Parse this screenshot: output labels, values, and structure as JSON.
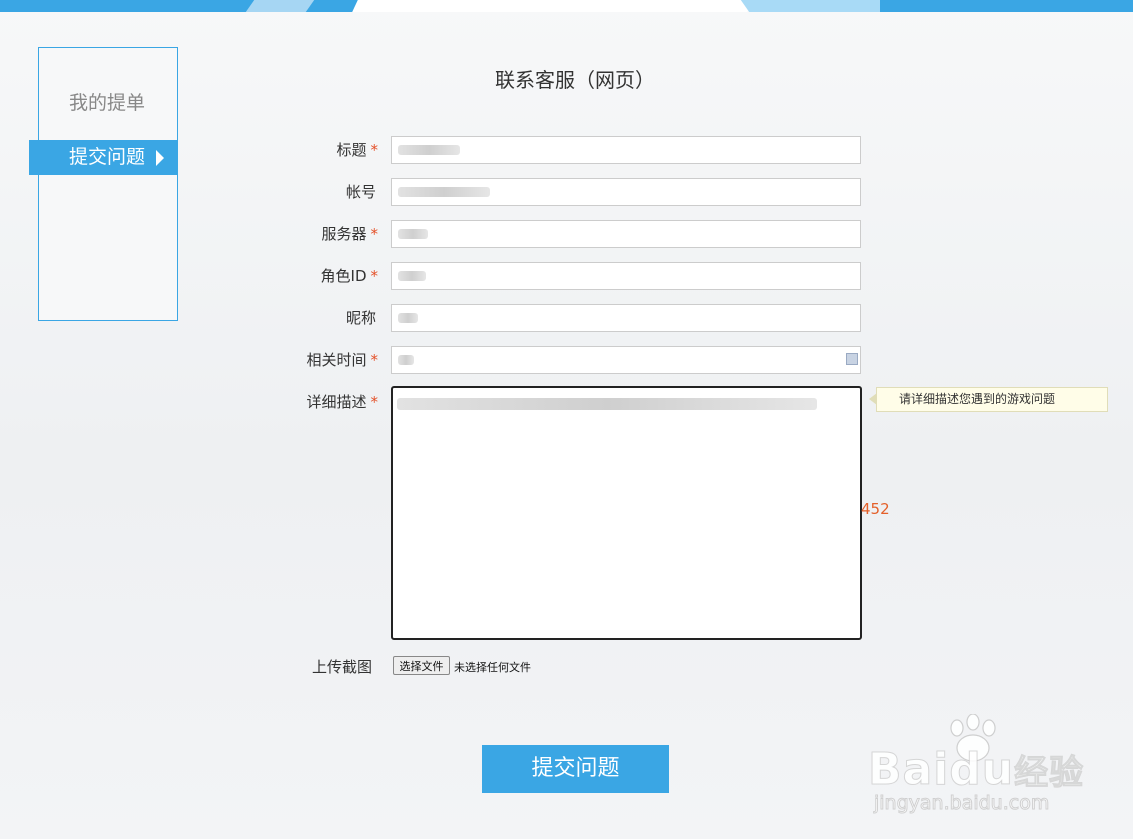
{
  "sidebar": {
    "items": [
      {
        "label": "我的提单"
      },
      {
        "label": "提交问题"
      }
    ]
  },
  "page": {
    "title": "联系客服（网页）"
  },
  "form": {
    "required_mark": "*",
    "fields": [
      {
        "label": "标题"
      },
      {
        "label": "帐号"
      },
      {
        "label": "服务器"
      },
      {
        "label": "角色ID"
      },
      {
        "label": "昵称"
      },
      {
        "label": "相关时间"
      },
      {
        "label": "详细描述"
      }
    ],
    "description_tip": "请详细描述您遇到的游戏问题",
    "char_counter": "452",
    "upload": {
      "label": "上传截图",
      "button": "选择文件",
      "status": "未选择任何文件"
    },
    "submit_label": "提交问题"
  },
  "watermark": {
    "brand": "Baidu",
    "suffix": "经验",
    "url": "jingyan.baidu.com"
  },
  "colors": {
    "accent": "#3aa6e4",
    "required": "#e4512a",
    "counter": "#e4602a"
  }
}
